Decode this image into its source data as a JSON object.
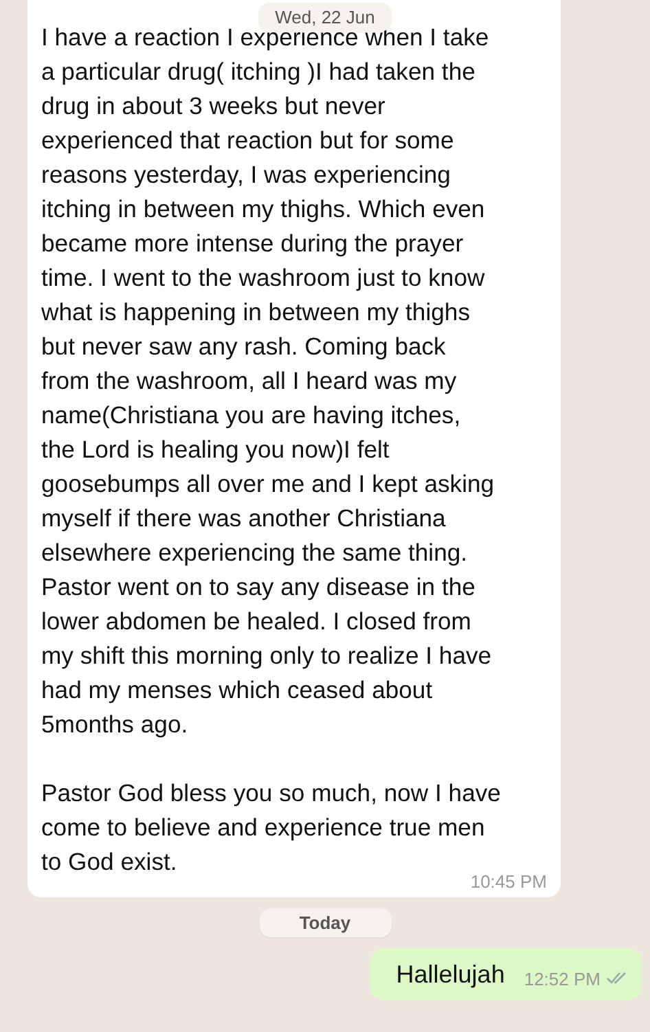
{
  "chat": {
    "items": [
      {
        "kind": "date",
        "label": "Wed, 22 Jun"
      },
      {
        "kind": "incoming",
        "paragraphs": [
          "I have a reaction I experience when I take\na particular drug( itching )I had taken the\ndrug in about 3 weeks but never\nexperienced that reaction but for some\nreasons yesterday, I was experiencing\nitching in between my thighs. Which even\nbecame more intense during the prayer\ntime. I went to the washroom just to know\nwhat is happening in between my thighs\nbut never saw any rash. Coming back\nfrom the washroom, all I heard was my\nname(Christiana you are having itches,\nthe Lord is healing you now)I felt\ngoosebumps all over me and I kept asking\nmyself if there was another Christiana\nelsewhere experiencing the same thing.\nPastor went on to say any disease in the\nlower abdomen be healed. I closed from\nmy shift this morning only to realize I have\nhad my menses which ceased about\n5months ago.",
          "Pastor God bless you so much, now I have\ncome to believe and experience true men\nto God exist."
        ],
        "time": "10:45 PM"
      },
      {
        "kind": "date",
        "label": "Today"
      },
      {
        "kind": "outgoing",
        "paragraphs": [
          "Hallelujah"
        ],
        "time": "12:52 PM"
      }
    ]
  }
}
